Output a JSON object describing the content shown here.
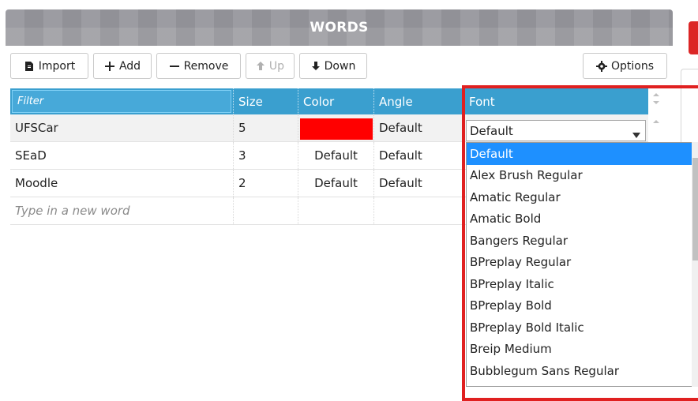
{
  "panel": {
    "title": "WORDS"
  },
  "toolbar": {
    "import_label": "Import",
    "add_label": "Add",
    "remove_label": "Remove",
    "up_label": "Up",
    "down_label": "Down",
    "options_label": "Options"
  },
  "table": {
    "filter_placeholder": "Filter",
    "columns": [
      "Size",
      "Color",
      "Angle",
      "Font"
    ],
    "rows": [
      {
        "word": "UFSCar",
        "size": "5",
        "color": "#ff0000",
        "angle": "Default",
        "font": "Default"
      },
      {
        "word": "SEaD",
        "size": "3",
        "color": "Default",
        "angle": "Default",
        "font": ""
      },
      {
        "word": "Moodle",
        "size": "2",
        "color": "Default",
        "angle": "Default",
        "font": ""
      }
    ],
    "new_word_placeholder": "Type in a new word"
  },
  "font_dropdown": {
    "selected": "Default",
    "options": [
      "Default",
      "Alex Brush Regular",
      "Amatic Regular",
      "Amatic Bold",
      "Bangers Regular",
      "BPreplay Regular",
      "BPreplay Italic",
      "BPreplay Bold",
      "BPreplay Bold Italic",
      "Breip Medium",
      "Bubblegum Sans Regular"
    ]
  },
  "colors": {
    "header_blue": "#3a9fcf",
    "selection_blue": "#1e90ff",
    "highlight_red": "#e02020"
  }
}
